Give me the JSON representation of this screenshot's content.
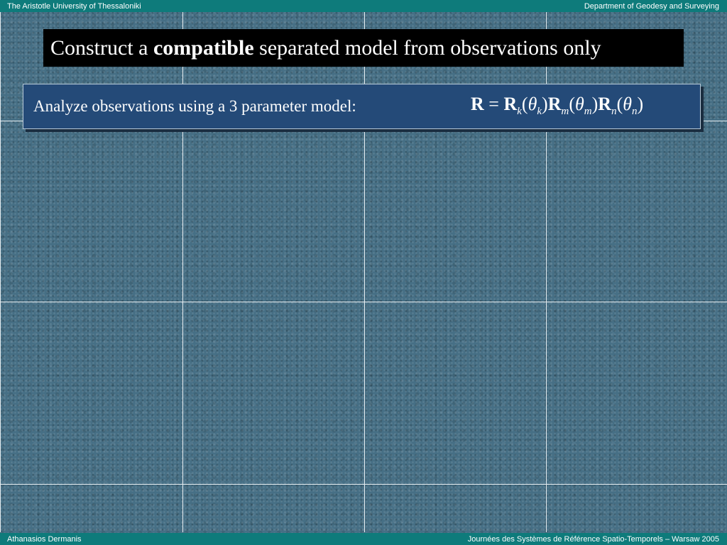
{
  "header": {
    "left": "The Aristotle University of Thessaloniki",
    "right": "Department of Geodesy and Surveying"
  },
  "title": {
    "prefix": "Construct a ",
    "emphasis": "compatible",
    "suffix": " separated model from observations only"
  },
  "content": {
    "text": "Analyze observations using a 3 parameter model:",
    "formula": {
      "lhs": "R",
      "eq": "=",
      "factors": [
        {
          "symbol": "R",
          "sub": "k",
          "arg": "θ",
          "arg_sub": "k"
        },
        {
          "symbol": "R",
          "sub": "m",
          "arg": "θ",
          "arg_sub": "m"
        },
        {
          "symbol": "R",
          "sub": "n",
          "arg": "θ",
          "arg_sub": "n"
        }
      ]
    }
  },
  "footer": {
    "left": "Athanasios Dermanis",
    "right": "Journées des Systèmes de Référence Spatio-Temporels – Warsaw 2005"
  }
}
